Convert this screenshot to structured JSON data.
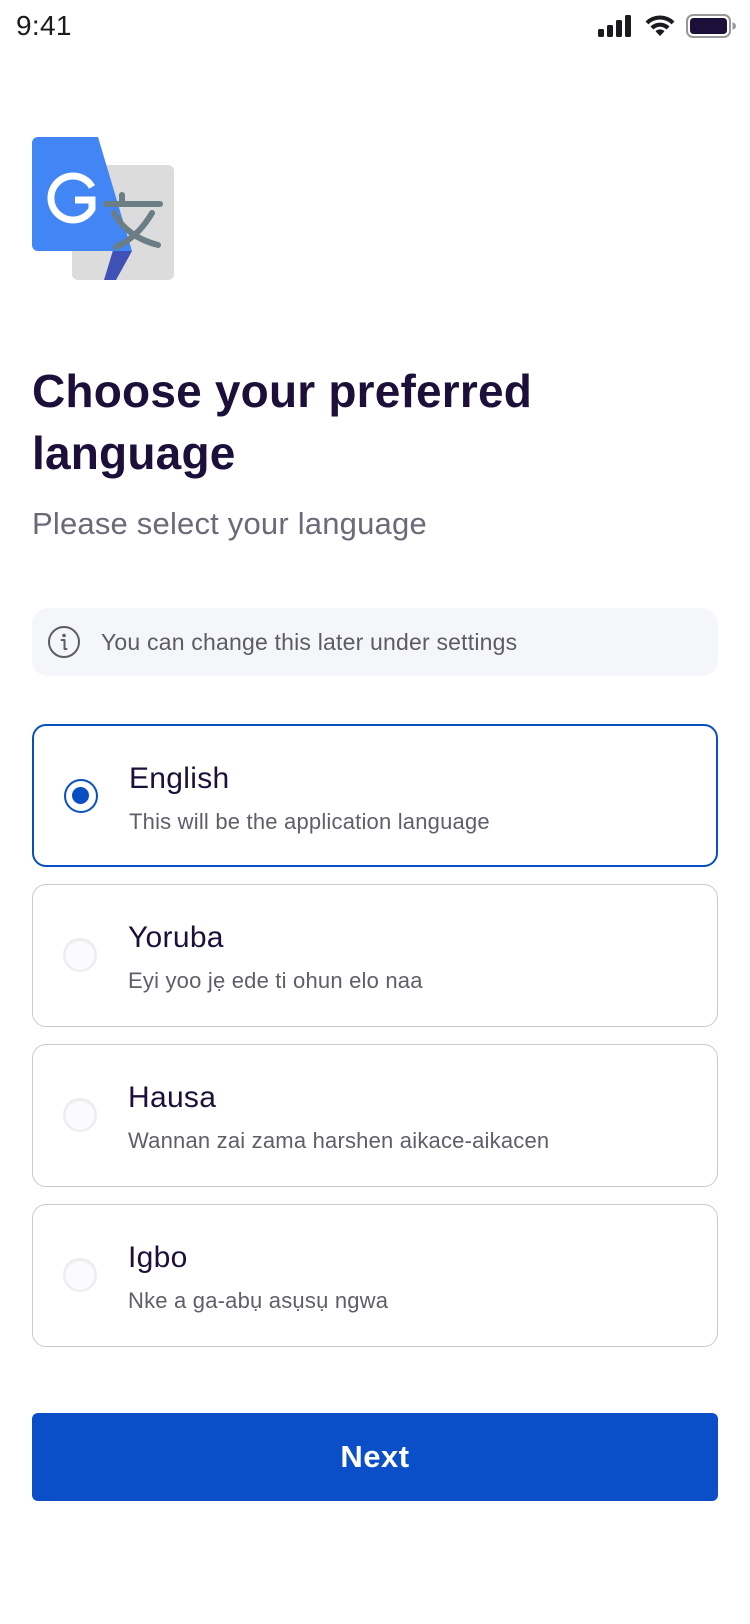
{
  "status_bar": {
    "time": "9:41",
    "icons": [
      "cellular-signal-icon",
      "wifi-icon",
      "battery-icon"
    ]
  },
  "logo": {
    "icon": "google-translate-logo"
  },
  "header": {
    "title": "Choose your preferred language",
    "subtitle": "Please select your language"
  },
  "info": {
    "icon": "info-icon",
    "text": "You can change this later under settings"
  },
  "languages": [
    {
      "name": "English",
      "description": "This will be the application language",
      "selected": true
    },
    {
      "name": "Yoruba",
      "description": "Eyi yoo jẹ ede ti ohun elo naa",
      "selected": false
    },
    {
      "name": "Hausa",
      "description": "Wannan zai zama harshen aikace-aikacen",
      "selected": false
    },
    {
      "name": "Igbo",
      "description": "Nke a ga-abụ asụsụ ngwa",
      "selected": false
    }
  ],
  "next_button": {
    "label": "Next"
  },
  "colors": {
    "accent": "#0A4FC7",
    "title_text": "#1C0F3A",
    "muted_text": "#6B6A78",
    "card_border": "#C9CAD3",
    "info_background": "#F5F6FA"
  }
}
